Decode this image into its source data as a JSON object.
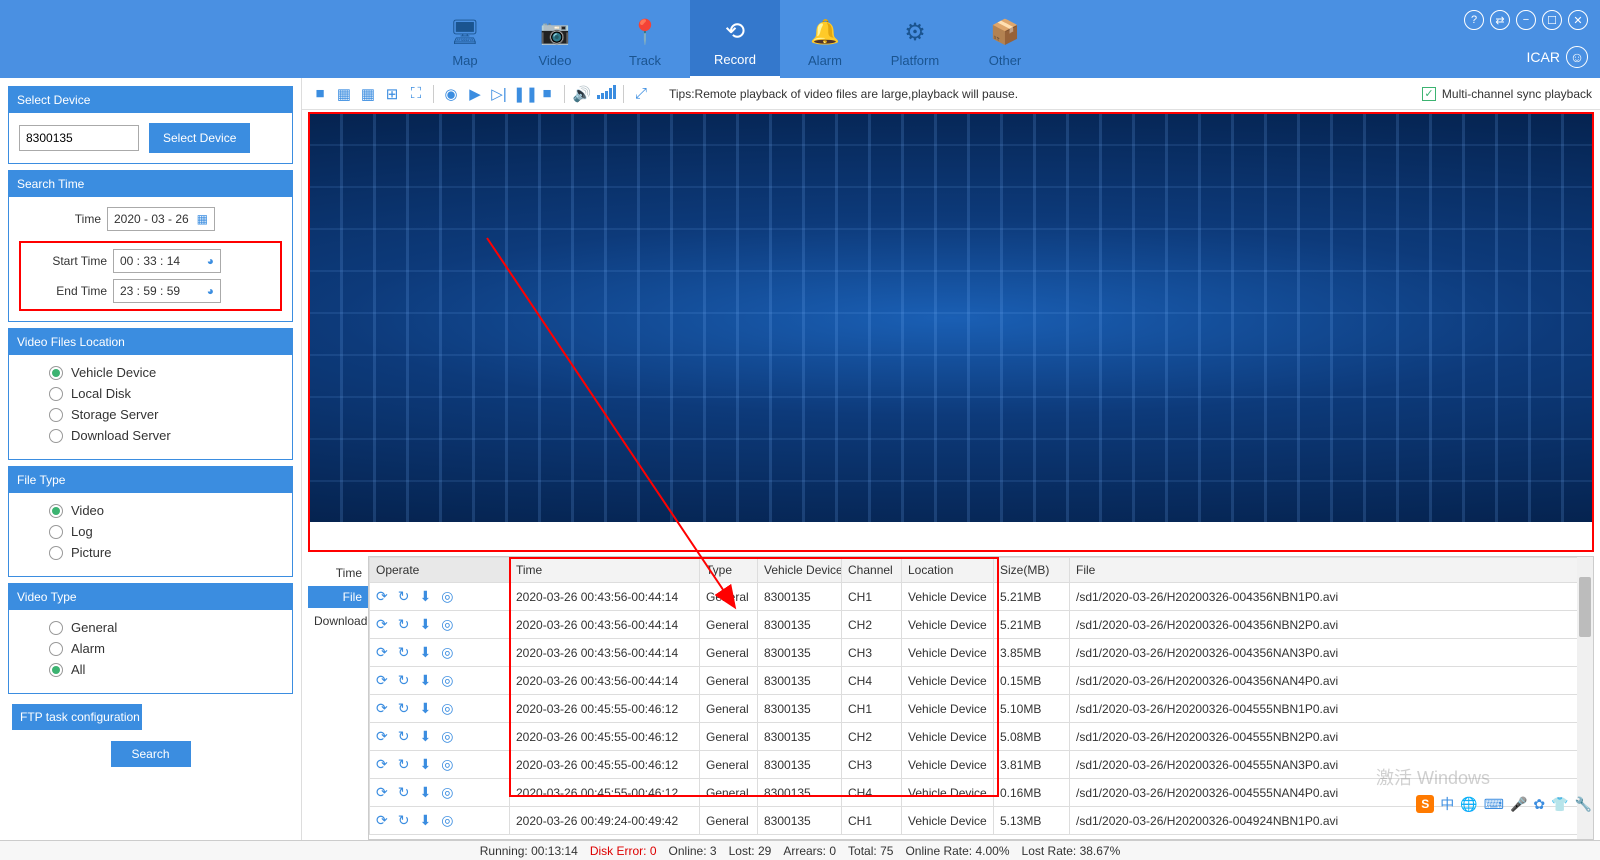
{
  "header": {
    "nav": [
      {
        "label": "Map",
        "icon": "🖥"
      },
      {
        "label": "Video",
        "icon": "📷"
      },
      {
        "label": "Track",
        "icon": "📍"
      },
      {
        "label": "Record",
        "icon": "⟲",
        "active": true
      },
      {
        "label": "Alarm",
        "icon": "🔔"
      },
      {
        "label": "Platform",
        "icon": "⚙"
      },
      {
        "label": "Other",
        "icon": "📦"
      }
    ],
    "user": "ICAR"
  },
  "sidebar": {
    "select_device": {
      "title": "Select Device",
      "value": "8300135",
      "button": "Select Device"
    },
    "search_time": {
      "title": "Search Time",
      "time_label": "Time",
      "date": "2020 - 03 - 26",
      "start_label": "Start Time",
      "start": "00 : 33 : 14",
      "end_label": "End Time",
      "end": "23 : 59 : 59"
    },
    "location": {
      "title": "Video Files Location",
      "options": [
        "Vehicle Device",
        "Local Disk",
        "Storage Server",
        "Download Server"
      ],
      "selected": 0
    },
    "file_type": {
      "title": "File Type",
      "options": [
        "Video",
        "Log",
        "Picture"
      ],
      "selected": 0
    },
    "video_type": {
      "title": "Video Type",
      "options": [
        "General",
        "Alarm",
        "All"
      ],
      "selected": 2
    },
    "ftp_button": "FTP task configuration",
    "search_button": "Search"
  },
  "toolbar": {
    "tips": "Tips:Remote playback of video files are large,playback will pause.",
    "sync_label": "Multi-channel sync playback"
  },
  "side_tabs": [
    "Time",
    "File",
    "Download"
  ],
  "side_tab_active": 1,
  "table": {
    "headers": [
      "Operate",
      "Time",
      "Type",
      "Vehicle Device",
      "Channel",
      "Location",
      "Size(MB)",
      "File"
    ],
    "rows": [
      {
        "time": "2020-03-26 00:43:56-00:44:14",
        "type": "General",
        "device": "8300135",
        "ch": "CH1",
        "loc": "Vehicle Device",
        "size": "5.21MB",
        "file": "/sd1/2020-03-26/H20200326-004356NBN1P0.avi"
      },
      {
        "time": "2020-03-26 00:43:56-00:44:14",
        "type": "General",
        "device": "8300135",
        "ch": "CH2",
        "loc": "Vehicle Device",
        "size": "5.21MB",
        "file": "/sd1/2020-03-26/H20200326-004356NBN2P0.avi"
      },
      {
        "time": "2020-03-26 00:43:56-00:44:14",
        "type": "General",
        "device": "8300135",
        "ch": "CH3",
        "loc": "Vehicle Device",
        "size": "3.85MB",
        "file": "/sd1/2020-03-26/H20200326-004356NAN3P0.avi"
      },
      {
        "time": "2020-03-26 00:43:56-00:44:14",
        "type": "General",
        "device": "8300135",
        "ch": "CH4",
        "loc": "Vehicle Device",
        "size": "0.15MB",
        "file": "/sd1/2020-03-26/H20200326-004356NAN4P0.avi"
      },
      {
        "time": "2020-03-26 00:45:55-00:46:12",
        "type": "General",
        "device": "8300135",
        "ch": "CH1",
        "loc": "Vehicle Device",
        "size": "5.10MB",
        "file": "/sd1/2020-03-26/H20200326-004555NBN1P0.avi"
      },
      {
        "time": "2020-03-26 00:45:55-00:46:12",
        "type": "General",
        "device": "8300135",
        "ch": "CH2",
        "loc": "Vehicle Device",
        "size": "5.08MB",
        "file": "/sd1/2020-03-26/H20200326-004555NBN2P0.avi"
      },
      {
        "time": "2020-03-26 00:45:55-00:46:12",
        "type": "General",
        "device": "8300135",
        "ch": "CH3",
        "loc": "Vehicle Device",
        "size": "3.81MB",
        "file": "/sd1/2020-03-26/H20200326-004555NAN3P0.avi"
      },
      {
        "time": "2020-03-26 00:45:55-00:46:12",
        "type": "General",
        "device": "8300135",
        "ch": "CH4",
        "loc": "Vehicle Device",
        "size": "0.16MB",
        "file": "/sd1/2020-03-26/H20200326-004555NAN4P0.avi"
      },
      {
        "time": "2020-03-26 00:49:24-00:49:42",
        "type": "General",
        "device": "8300135",
        "ch": "CH1",
        "loc": "Vehicle Device",
        "size": "5.13MB",
        "file": "/sd1/2020-03-26/H20200326-004924NBN1P0.avi"
      }
    ]
  },
  "status": {
    "running_label": "Running:",
    "running": "00:13:14",
    "disk_error_label": "Disk Error:",
    "disk_error": "0",
    "online_label": "Online:",
    "online": "3",
    "lost_label": "Lost:",
    "lost": "29",
    "arrears_label": "Arrears:",
    "arrears": "0",
    "total_label": "Total:",
    "total": "75",
    "online_rate_label": "Online Rate:",
    "online_rate": "4.00%",
    "lost_rate_label": "Lost Rate:",
    "lost_rate": "38.67%"
  },
  "watermark": "激活 Windows"
}
